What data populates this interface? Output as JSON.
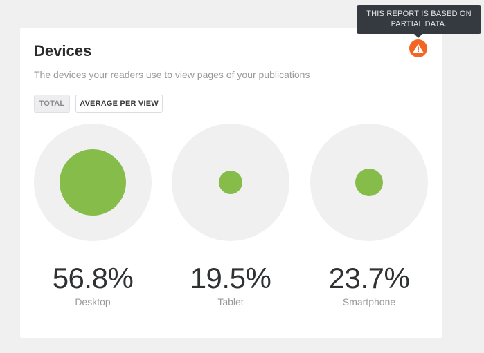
{
  "tooltip": {
    "line1": "THIS REPORT IS BASED ON",
    "line2": "PARTIAL DATA."
  },
  "card": {
    "title": "Devices",
    "subtitle": "The devices your readers use to view pages of your publications",
    "toggles": {
      "total": "TOTAL",
      "average": "AVERAGE PER VIEW"
    },
    "warning_icon": "warning-triangle-icon",
    "accent_color": "#86bc4a",
    "warning_color": "#f26522"
  },
  "devices": [
    {
      "name": "Desktop",
      "percent": "56.8%",
      "value": 56.8
    },
    {
      "name": "Tablet",
      "percent": "19.5%",
      "value": 19.5
    },
    {
      "name": "Smartphone",
      "percent": "23.7%",
      "value": 23.7
    }
  ]
}
